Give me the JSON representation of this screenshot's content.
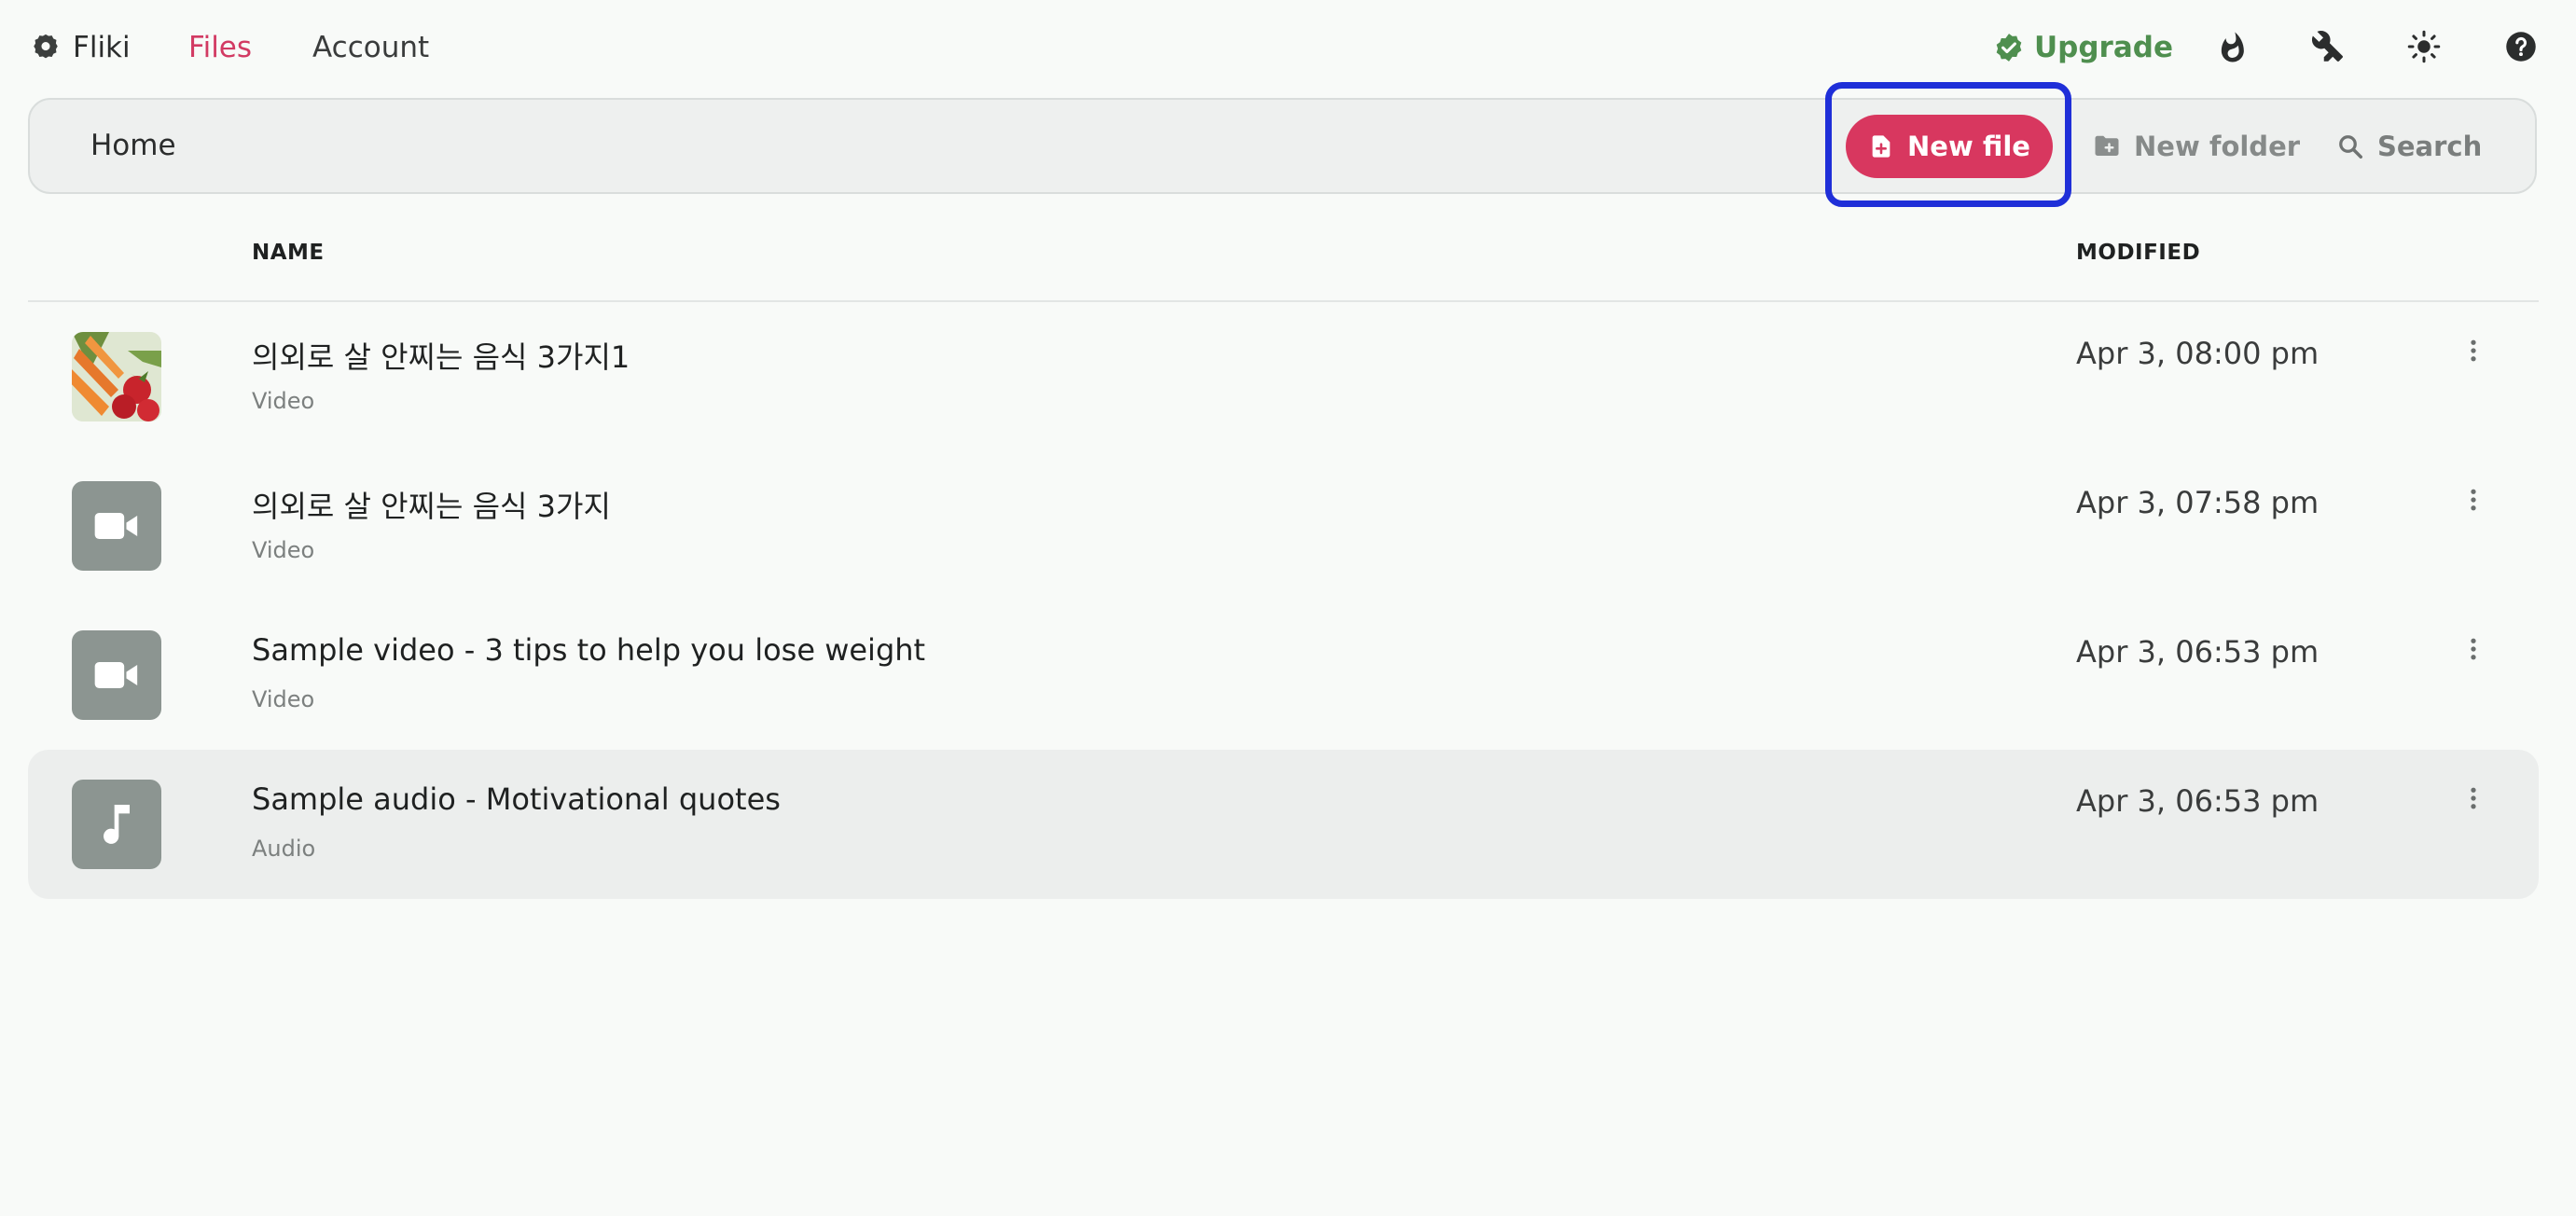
{
  "app": {
    "name": "Fliki"
  },
  "nav": {
    "files": "Files",
    "account": "Account",
    "upgrade": "Upgrade"
  },
  "toolbar": {
    "breadcrumb": "Home",
    "new_file": "New file",
    "new_folder": "New folder",
    "search": "Search"
  },
  "table": {
    "headers": {
      "name": "NAME",
      "modified": "MODIFIED"
    },
    "rows": [
      {
        "name": "의외로 살 안찌는 음식 3가지1",
        "type": "Video",
        "modified": "Apr 3, 08:00 pm",
        "thumb": "image"
      },
      {
        "name": "의외로 살 안찌는 음식 3가지",
        "type": "Video",
        "modified": "Apr 3, 07:58 pm",
        "thumb": "video-icon"
      },
      {
        "name": "Sample video - 3 tips to help you lose weight",
        "type": "Video",
        "modified": "Apr 3, 06:53 pm",
        "thumb": "video-icon"
      },
      {
        "name": "Sample audio - Motivational quotes",
        "type": "Audio",
        "modified": "Apr 3, 06:53 pm",
        "thumb": "music-note-icon"
      }
    ]
  },
  "colors": {
    "brand_accent": "#d8375f",
    "upgrade_green": "#4f8f4f",
    "highlight_frame": "#1f2fd8",
    "thumb_bg": "#8c9591"
  }
}
